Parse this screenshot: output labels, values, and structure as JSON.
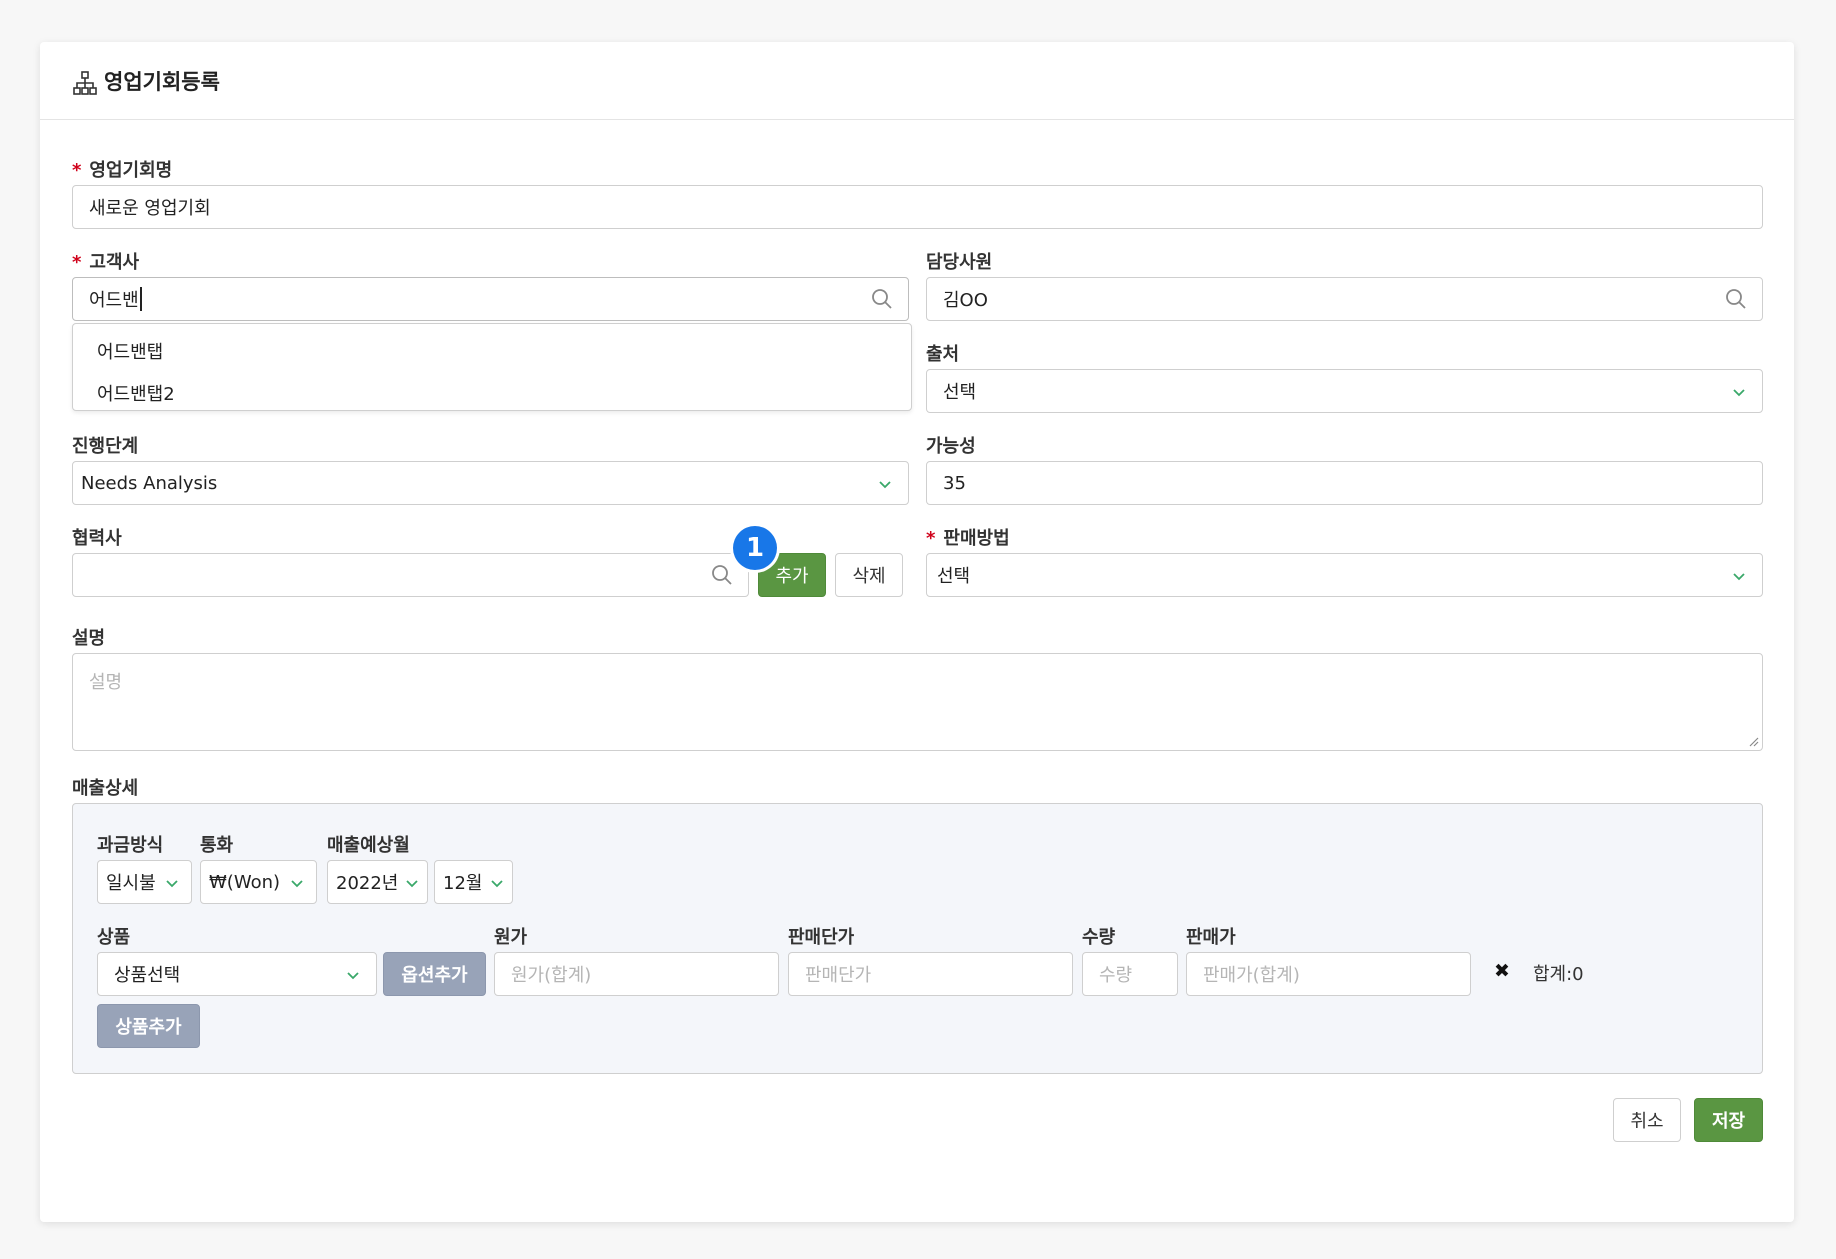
{
  "form": {
    "title": "영업기회등록",
    "opportunity_name": {
      "label": "영업기회명",
      "value": "새로운 영업기회"
    },
    "customer": {
      "label": "고객사",
      "value": "어드밴",
      "suggestions": [
        "어드밴탭",
        "어드밴탭2"
      ]
    },
    "manager": {
      "label": "담당사원",
      "value": "김OO"
    },
    "source": {
      "label": "출처",
      "value": "선택"
    },
    "stage": {
      "label": "진행단계",
      "value": "Needs Analysis"
    },
    "probability": {
      "label": "가능성",
      "value": "35"
    },
    "partner": {
      "label": "협력사",
      "value": "",
      "badge": "1",
      "add_label": "추가",
      "delete_label": "삭제"
    },
    "sales_method": {
      "label": "판매방법",
      "value": "선택"
    },
    "description": {
      "label": "설명",
      "placeholder": "설명"
    },
    "required_mark": "*"
  },
  "sales_detail": {
    "label": "매출상세",
    "billing": {
      "label": "과금방식",
      "value": "일시불"
    },
    "currency": {
      "label": "통화",
      "value": "₩(Won)"
    },
    "expected_month": {
      "label": "매출예상월",
      "year": "2022년",
      "month": "12월"
    },
    "product": {
      "label": "상품",
      "value": "상품선택",
      "option_add_label": "옵션추가"
    },
    "cost": {
      "label": "원가",
      "placeholder": "원가(합계)"
    },
    "unit_price": {
      "label": "판매단가",
      "placeholder": "판매단가"
    },
    "quantity": {
      "label": "수량",
      "placeholder": "수량"
    },
    "sale_price": {
      "label": "판매가",
      "placeholder": "판매가(합계)"
    },
    "remove_symbol": "✖",
    "total_text": "합계:0",
    "add_product_label": "상품추가"
  },
  "footer": {
    "cancel_label": "취소",
    "save_label": "저장"
  },
  "colors": {
    "accent_green": "#5a9642",
    "badge_blue": "#1877e8",
    "required_red": "#d0021b",
    "chevron_green": "#3aa86a"
  }
}
